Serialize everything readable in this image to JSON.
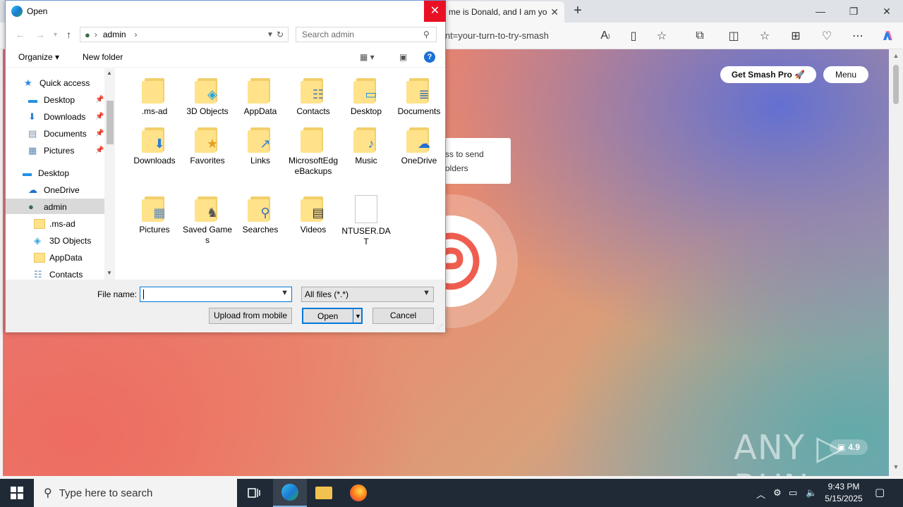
{
  "browser": {
    "tab_title": "me is Donald, and I am yo",
    "address_text": "tent=your-turn-to-try-smash",
    "controls": {
      "minimize": "—",
      "restore": "❐",
      "close": "✕"
    }
  },
  "webpage": {
    "get_pro_label": "Get Smash Pro 🚀",
    "menu_label": "Menu",
    "tooltip_line1": "ss to send",
    "tooltip_line2": "olders",
    "rating": "4.9",
    "watermark": "ANY ▷ RUN"
  },
  "dialog": {
    "title": "Open",
    "breadcrumb_item": "admin",
    "search_placeholder": "Search admin",
    "organize_label": "Organize ▾",
    "new_folder_label": "New folder",
    "help_label": "?",
    "nav_items": [
      {
        "label": "Quick access",
        "icon": "star-icon",
        "pinned": false
      },
      {
        "label": "Desktop",
        "icon": "desktop-icon",
        "pinned": true
      },
      {
        "label": "Downloads",
        "icon": "downloads-icon",
        "pinned": true
      },
      {
        "label": "Documents",
        "icon": "documents-icon",
        "pinned": true
      },
      {
        "label": "Pictures",
        "icon": "pictures-icon",
        "pinned": true
      },
      {
        "label": "Desktop",
        "icon": "desktop-icon",
        "pinned": false
      },
      {
        "label": "OneDrive",
        "icon": "cloud-icon",
        "pinned": false
      },
      {
        "label": "admin",
        "icon": "user-icon",
        "pinned": false,
        "selected": true
      },
      {
        "label": ".ms-ad",
        "icon": "folder-icon",
        "pinned": false
      },
      {
        "label": "3D Objects",
        "icon": "cube-icon",
        "pinned": false
      },
      {
        "label": "AppData",
        "icon": "folder-icon",
        "pinned": false
      },
      {
        "label": "Contacts",
        "icon": "contacts-icon",
        "pinned": false
      }
    ],
    "files": [
      {
        "label": ".ms-ad",
        "emblem": ""
      },
      {
        "label": "3D Objects",
        "emblem": "◈"
      },
      {
        "label": "AppData",
        "emblem": ""
      },
      {
        "label": "Contacts",
        "emblem": "☷"
      },
      {
        "label": "Desktop",
        "emblem": "▭"
      },
      {
        "label": "Documents",
        "emblem": "≣"
      },
      {
        "label": "Downloads",
        "emblem": "⬇"
      },
      {
        "label": "Favorites",
        "emblem": "★"
      },
      {
        "label": "Links",
        "emblem": "↗"
      },
      {
        "label": "MicrosoftEdgeBackups",
        "emblem": ""
      },
      {
        "label": "Music",
        "emblem": "♪"
      },
      {
        "label": "OneDrive",
        "emblem": "☁"
      },
      {
        "label": "Pictures",
        "emblem": "▦"
      },
      {
        "label": "Saved Games",
        "emblem": "♞"
      },
      {
        "label": "Searches",
        "emblem": "⚲"
      },
      {
        "label": "Videos",
        "emblem": "▤"
      },
      {
        "label": "NTUSER.DAT",
        "emblem": "",
        "type": "file"
      }
    ],
    "file_name_label": "File name:",
    "file_name_value": "",
    "filter_value": "All files (*.*)",
    "upload_label": "Upload from mobile",
    "open_label": "Open",
    "cancel_label": "Cancel"
  },
  "taskbar": {
    "search_placeholder": "Type here to search",
    "time": "9:43 PM",
    "date": "5/15/2025"
  },
  "colors": {
    "accent": "#0078d7",
    "close_red": "#e81123",
    "taskbar": "#1f2a36"
  }
}
